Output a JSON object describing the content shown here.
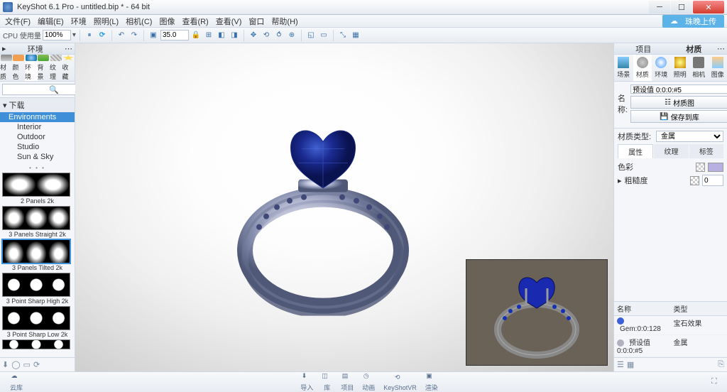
{
  "titlebar": {
    "title": "KeyShot 6.1 Pro - untitled.bip * - 64 bit"
  },
  "menu": [
    "文件(F)",
    "编辑(E)",
    "环境",
    "照明(L)",
    "相机(C)",
    "图像",
    "查看(R)",
    "查看(V)",
    "窗口",
    "帮助(H)"
  ],
  "cloud_button": "珠晚上传",
  "toolbar": {
    "cpu_label": "CPU 使用量",
    "cpu_value": "100% ",
    "zoom_value": "35.0"
  },
  "left": {
    "title": "环境",
    "tabs": [
      "材质",
      "颜色",
      "环境",
      "背景",
      "纹理",
      "收藏"
    ],
    "active_tab": 2,
    "search_placeholder": "",
    "tree_header": "下载",
    "tree_sel": "Environments",
    "tree_children": [
      "Interior",
      "Outdoor",
      "Studio",
      "Sun & Sky"
    ],
    "thumbs": [
      {
        "label": "2 Panels 2k",
        "cls": ""
      },
      {
        "label": "3 Panels Straight 2k",
        "cls": ""
      },
      {
        "label": "3 Panels Tilted 2k",
        "cls": "tilt",
        "sel": true
      },
      {
        "label": "3 Point Sharp High 2k",
        "cls": "sharp"
      },
      {
        "label": "3 Point Sharp Low 2k",
        "cls": "sharp"
      },
      {
        "label": "",
        "cls": "sharp"
      }
    ]
  },
  "right": {
    "panel_left_title": "项目",
    "panel_title": "材质",
    "tabs": [
      "场景",
      "材质",
      "环境",
      "照明",
      "相机",
      "图像"
    ],
    "active_tab": 1,
    "name_label": "名称:",
    "name_value": "预设值 0:0:0:#5",
    "btn_graph": "材质图",
    "btn_save": "保存到库",
    "type_label": "材质类型:",
    "type_value": "金属",
    "subtabs": [
      "属性",
      "纹理",
      "标签"
    ],
    "color_label": "色彩",
    "rough_label": "粗糙度",
    "rough_value": "0",
    "color_swatch": "#b8b0e0",
    "table": {
      "head": [
        "名称",
        "类型"
      ],
      "rows": [
        {
          "icon": "#3a5fd8",
          "name": "Gem:0:0:128",
          "type": "宝石效果"
        },
        {
          "icon": "#b0b0c0",
          "name": "预设值 0:0:0:#5",
          "type": "金属"
        }
      ]
    }
  },
  "bottom": {
    "cloud": "云库",
    "buttons": [
      "导入",
      "库",
      "项目",
      "动画",
      "KeyShotVR",
      "渲染"
    ]
  }
}
